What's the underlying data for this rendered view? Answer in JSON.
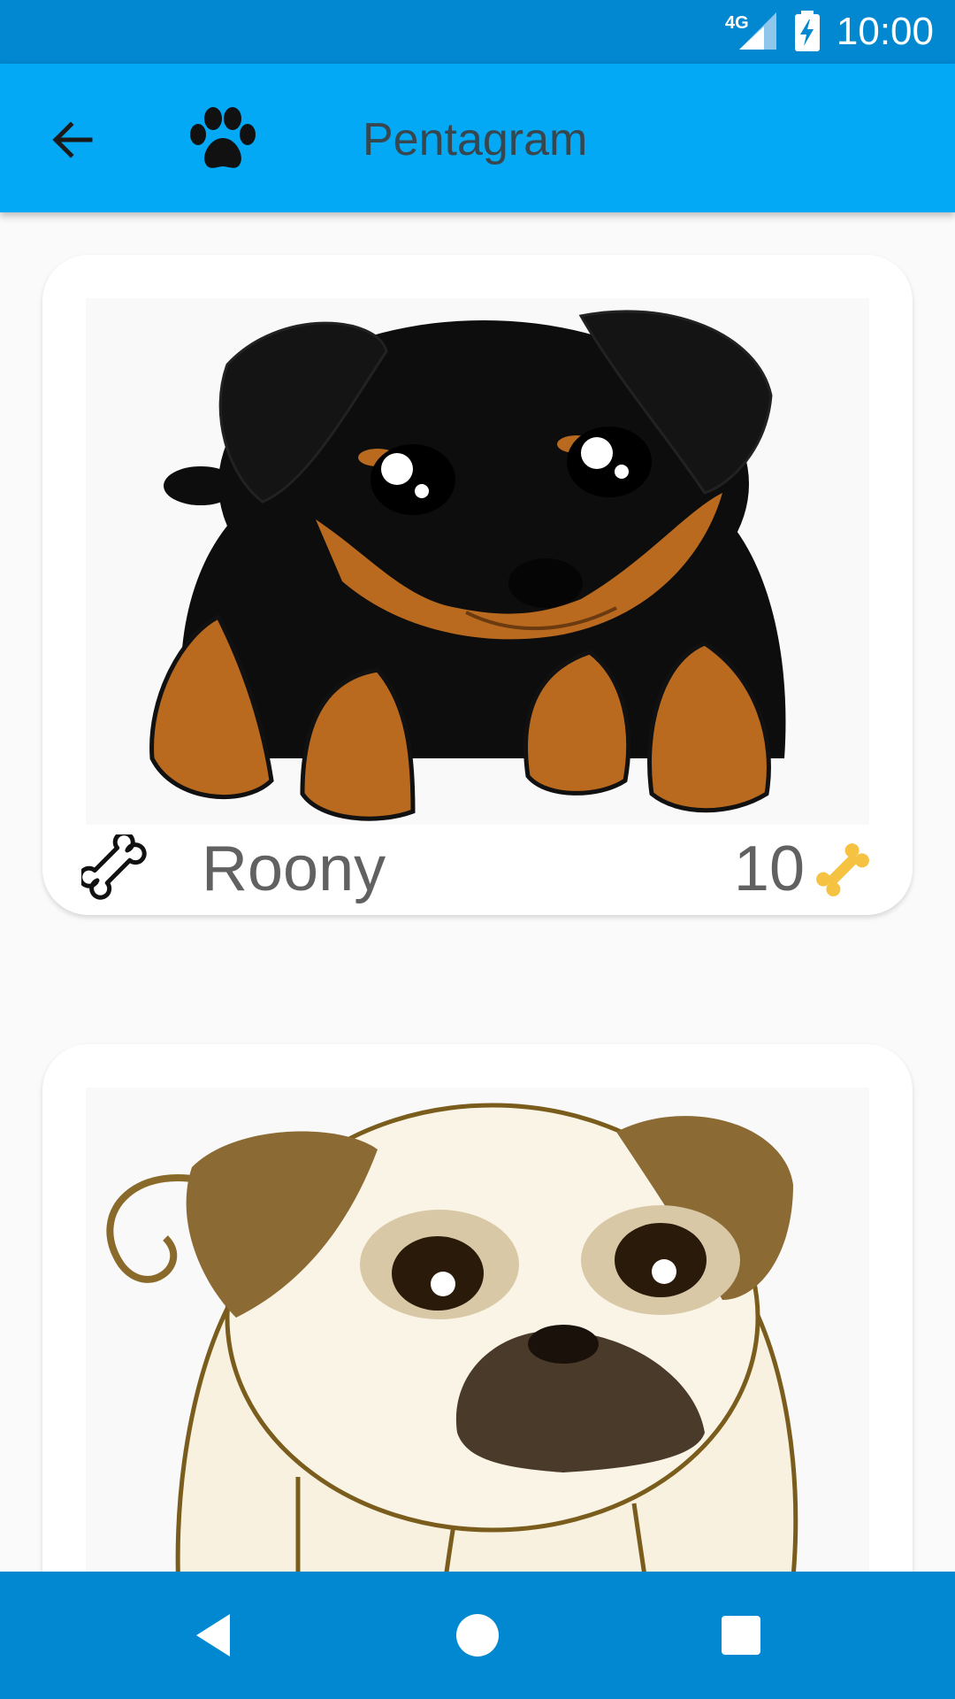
{
  "status_bar": {
    "network": "4G",
    "time": "10:00"
  },
  "app_bar": {
    "title": "Pentagram",
    "icons": [
      "arrow-back-icon",
      "paw-icon"
    ]
  },
  "feed": {
    "posts": [
      {
        "name": "Roony",
        "score": "10",
        "image": "rottweiler-puppy-illustration",
        "icons": [
          "bone-outline-icon",
          "bone-gold-icon"
        ]
      },
      {
        "image": "pug-puppy-illustration"
      }
    ]
  },
  "nav_bar": {
    "icons": [
      "nav-back-icon",
      "nav-home-icon",
      "nav-recents-icon"
    ]
  },
  "colors": {
    "status_bar": "#0288d1",
    "app_bar": "#03a9f4",
    "background": "#fafafa",
    "card": "#ffffff",
    "title_text": "#37474f",
    "card_text": "#616161",
    "bone_gold": "#f5c242"
  }
}
